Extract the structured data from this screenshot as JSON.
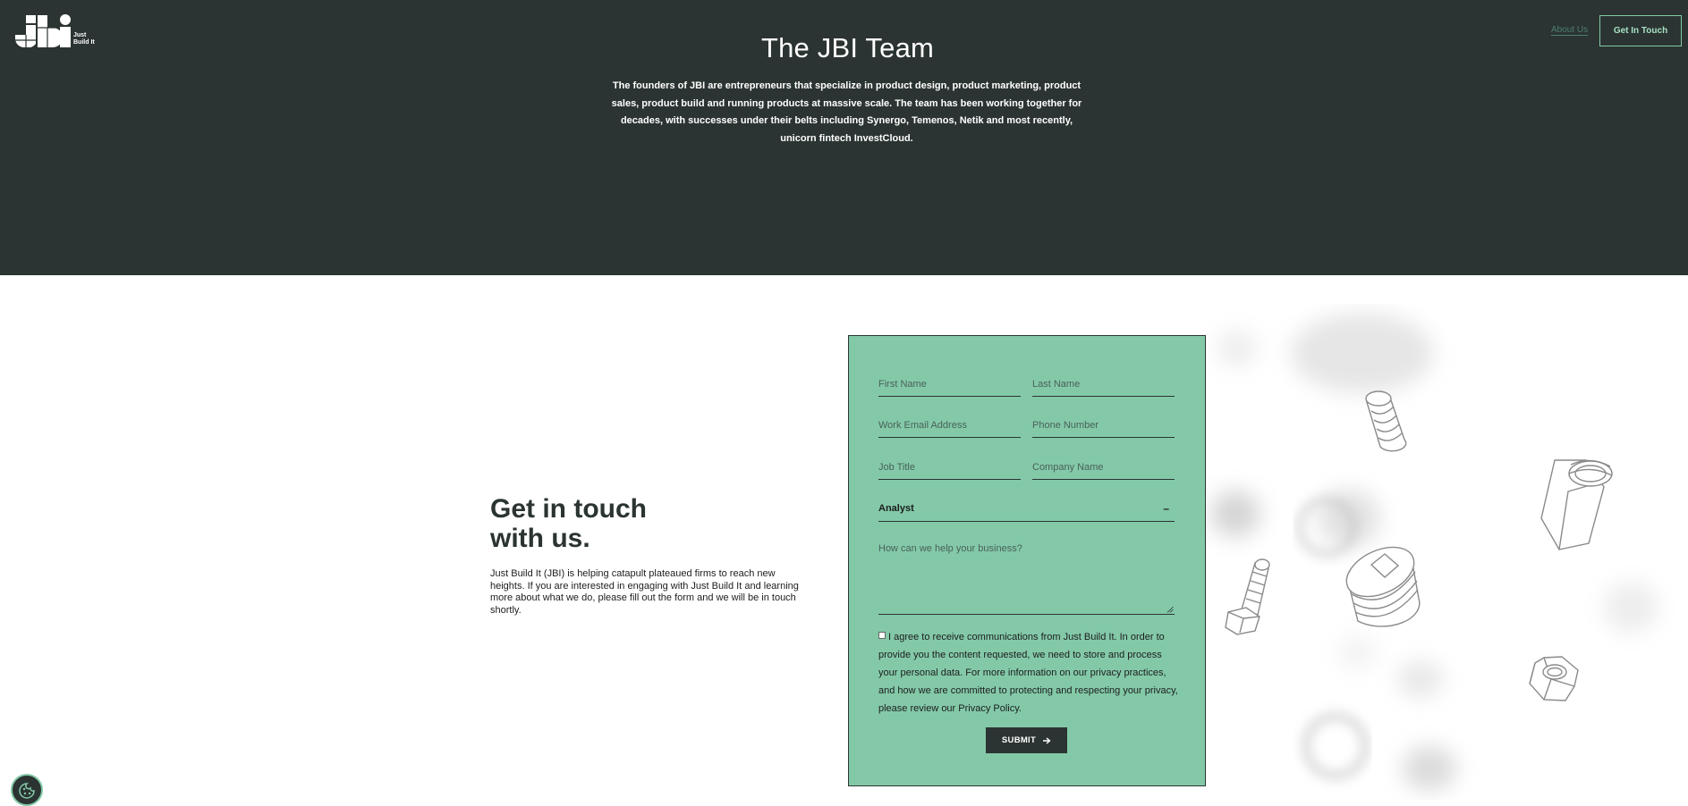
{
  "brand": {
    "logo_text": "JBI",
    "tagline": "Just\nBuild It"
  },
  "nav": {
    "about": "About Us",
    "cta": "Get In Touch"
  },
  "hero": {
    "title": "The JBI Team",
    "description": "The founders of JBI are entrepreneurs that specialize in product design, product marketing, product sales, product build and running products at massive scale. The team has been working together for decades, with successes under their belts including Synergo, Temenos, Netik and most recently, unicorn fintech InvestCloud."
  },
  "contact": {
    "heading_line1": "Get in touch",
    "heading_line2": "with us.",
    "body": "Just Build It (JBI) is helping catapult plateaued firms to reach new heights. If you are interested in engaging with Just Build It and learning more about what we do, please fill out the form and we will be in touch shortly."
  },
  "form": {
    "first_name": "First Name",
    "last_name": "Last Name",
    "email": "Work Email Address",
    "phone": "Phone Number",
    "job_title": "Job Title",
    "company": "Company Name",
    "role_selected": "Analyst",
    "message": "How can we help your business?",
    "consent": "I agree to receive communications from Just Build It. In order to provide you the content requested, we need to store and process your personal data. For more information on our privacy practices, and how we are committed to protecting and respecting your privacy, please review our Privacy Policy.",
    "submit": "SUBMIT"
  },
  "icons": {
    "submit_arrow": "arrow-right-icon",
    "select": "chevron-down-icon",
    "cookie": "cookie-icon"
  },
  "colors": {
    "hero_bg": "#2b3432",
    "accent_green": "#83c9a8",
    "text_dark": "#2b3432"
  }
}
